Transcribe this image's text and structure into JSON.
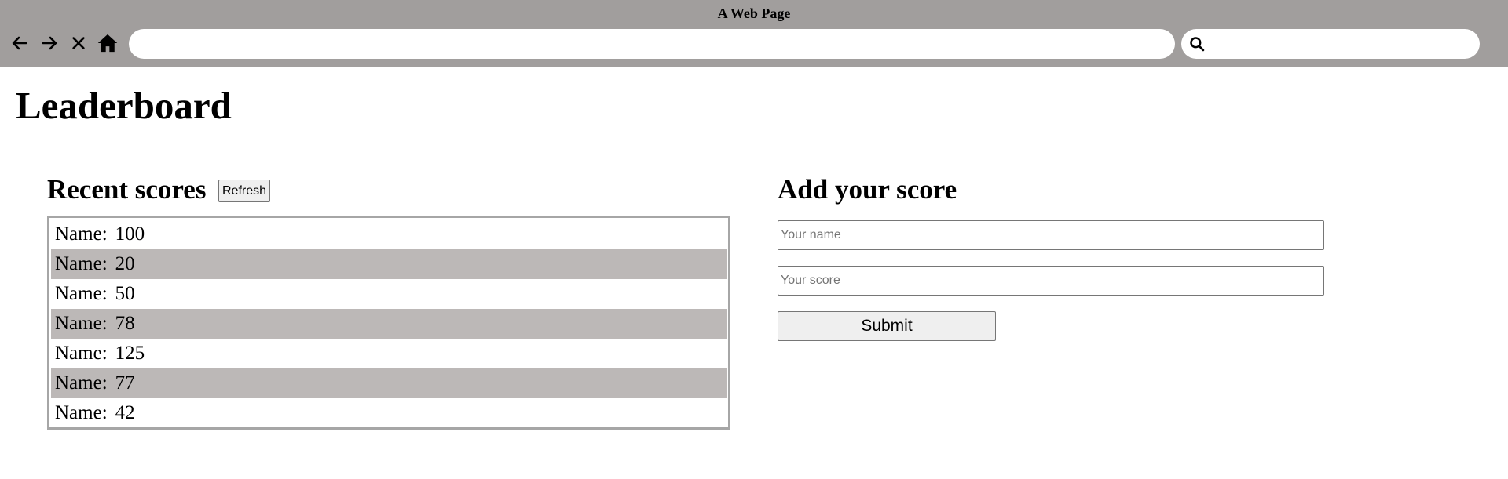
{
  "window": {
    "title": "A Web Page"
  },
  "toolbar": {
    "back_icon": "back-arrow-icon",
    "forward_icon": "forward-arrow-icon",
    "stop_icon": "close-icon",
    "home_icon": "home-icon",
    "url_value": "",
    "search_icon": "search-icon",
    "search_value": ""
  },
  "page": {
    "title": "Leaderboard"
  },
  "scores": {
    "heading": "Recent scores",
    "refresh_label": "Refresh",
    "rows": [
      {
        "name": "Name:",
        "score": "100"
      },
      {
        "name": "Name:",
        "score": "20"
      },
      {
        "name": "Name:",
        "score": "50"
      },
      {
        "name": "Name:",
        "score": "78"
      },
      {
        "name": "Name:",
        "score": "125"
      },
      {
        "name": "Name:",
        "score": "77"
      },
      {
        "name": "Name:",
        "score": "42"
      }
    ]
  },
  "form": {
    "heading": "Add your score",
    "name_placeholder": "Your name",
    "score_placeholder": "Your score",
    "submit_label": "Submit"
  },
  "colors": {
    "chrome_bg": "#a19e9d",
    "row_alt_bg": "#bcb8b7"
  }
}
